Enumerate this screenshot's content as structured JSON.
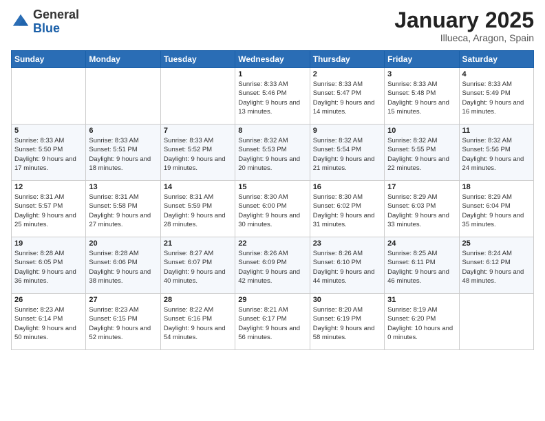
{
  "header": {
    "logo": {
      "general": "General",
      "blue": "Blue"
    },
    "title": "January 2025",
    "location": "Illueca, Aragon, Spain"
  },
  "days_of_week": [
    "Sunday",
    "Monday",
    "Tuesday",
    "Wednesday",
    "Thursday",
    "Friday",
    "Saturday"
  ],
  "weeks": [
    [
      null,
      null,
      null,
      {
        "day": 1,
        "sunrise": "8:33 AM",
        "sunset": "5:46 PM",
        "daylight": "9 hours and 13 minutes."
      },
      {
        "day": 2,
        "sunrise": "8:33 AM",
        "sunset": "5:47 PM",
        "daylight": "9 hours and 14 minutes."
      },
      {
        "day": 3,
        "sunrise": "8:33 AM",
        "sunset": "5:48 PM",
        "daylight": "9 hours and 15 minutes."
      },
      {
        "day": 4,
        "sunrise": "8:33 AM",
        "sunset": "5:49 PM",
        "daylight": "9 hours and 16 minutes."
      }
    ],
    [
      {
        "day": 5,
        "sunrise": "8:33 AM",
        "sunset": "5:50 PM",
        "daylight": "9 hours and 17 minutes."
      },
      {
        "day": 6,
        "sunrise": "8:33 AM",
        "sunset": "5:51 PM",
        "daylight": "9 hours and 18 minutes."
      },
      {
        "day": 7,
        "sunrise": "8:33 AM",
        "sunset": "5:52 PM",
        "daylight": "9 hours and 19 minutes."
      },
      {
        "day": 8,
        "sunrise": "8:32 AM",
        "sunset": "5:53 PM",
        "daylight": "9 hours and 20 minutes."
      },
      {
        "day": 9,
        "sunrise": "8:32 AM",
        "sunset": "5:54 PM",
        "daylight": "9 hours and 21 minutes."
      },
      {
        "day": 10,
        "sunrise": "8:32 AM",
        "sunset": "5:55 PM",
        "daylight": "9 hours and 22 minutes."
      },
      {
        "day": 11,
        "sunrise": "8:32 AM",
        "sunset": "5:56 PM",
        "daylight": "9 hours and 24 minutes."
      }
    ],
    [
      {
        "day": 12,
        "sunrise": "8:31 AM",
        "sunset": "5:57 PM",
        "daylight": "9 hours and 25 minutes."
      },
      {
        "day": 13,
        "sunrise": "8:31 AM",
        "sunset": "5:58 PM",
        "daylight": "9 hours and 27 minutes."
      },
      {
        "day": 14,
        "sunrise": "8:31 AM",
        "sunset": "5:59 PM",
        "daylight": "9 hours and 28 minutes."
      },
      {
        "day": 15,
        "sunrise": "8:30 AM",
        "sunset": "6:00 PM",
        "daylight": "9 hours and 30 minutes."
      },
      {
        "day": 16,
        "sunrise": "8:30 AM",
        "sunset": "6:02 PM",
        "daylight": "9 hours and 31 minutes."
      },
      {
        "day": 17,
        "sunrise": "8:29 AM",
        "sunset": "6:03 PM",
        "daylight": "9 hours and 33 minutes."
      },
      {
        "day": 18,
        "sunrise": "8:29 AM",
        "sunset": "6:04 PM",
        "daylight": "9 hours and 35 minutes."
      }
    ],
    [
      {
        "day": 19,
        "sunrise": "8:28 AM",
        "sunset": "6:05 PM",
        "daylight": "9 hours and 36 minutes."
      },
      {
        "day": 20,
        "sunrise": "8:28 AM",
        "sunset": "6:06 PM",
        "daylight": "9 hours and 38 minutes."
      },
      {
        "day": 21,
        "sunrise": "8:27 AM",
        "sunset": "6:07 PM",
        "daylight": "9 hours and 40 minutes."
      },
      {
        "day": 22,
        "sunrise": "8:26 AM",
        "sunset": "6:09 PM",
        "daylight": "9 hours and 42 minutes."
      },
      {
        "day": 23,
        "sunrise": "8:26 AM",
        "sunset": "6:10 PM",
        "daylight": "9 hours and 44 minutes."
      },
      {
        "day": 24,
        "sunrise": "8:25 AM",
        "sunset": "6:11 PM",
        "daylight": "9 hours and 46 minutes."
      },
      {
        "day": 25,
        "sunrise": "8:24 AM",
        "sunset": "6:12 PM",
        "daylight": "9 hours and 48 minutes."
      }
    ],
    [
      {
        "day": 26,
        "sunrise": "8:23 AM",
        "sunset": "6:14 PM",
        "daylight": "9 hours and 50 minutes."
      },
      {
        "day": 27,
        "sunrise": "8:23 AM",
        "sunset": "6:15 PM",
        "daylight": "9 hours and 52 minutes."
      },
      {
        "day": 28,
        "sunrise": "8:22 AM",
        "sunset": "6:16 PM",
        "daylight": "9 hours and 54 minutes."
      },
      {
        "day": 29,
        "sunrise": "8:21 AM",
        "sunset": "6:17 PM",
        "daylight": "9 hours and 56 minutes."
      },
      {
        "day": 30,
        "sunrise": "8:20 AM",
        "sunset": "6:19 PM",
        "daylight": "9 hours and 58 minutes."
      },
      {
        "day": 31,
        "sunrise": "8:19 AM",
        "sunset": "6:20 PM",
        "daylight": "10 hours and 0 minutes."
      },
      null
    ]
  ]
}
